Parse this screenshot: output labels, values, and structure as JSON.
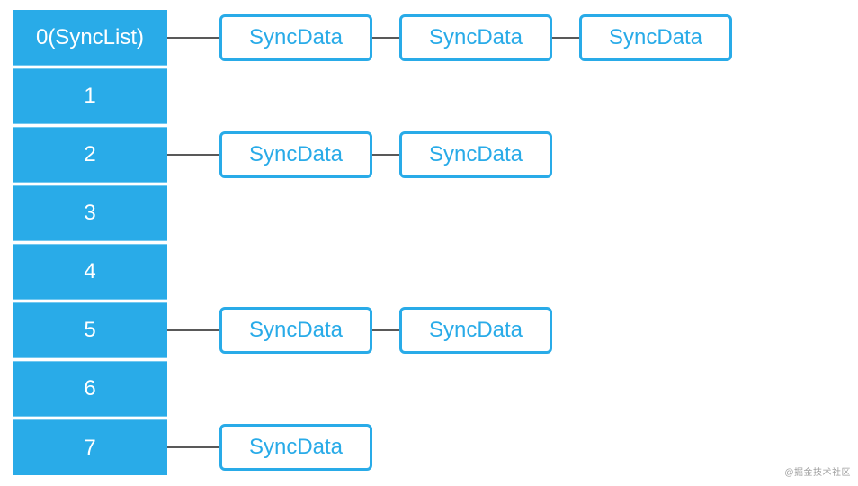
{
  "colors": {
    "accent": "#29abe8",
    "connector": "#595959",
    "node_text": "#29abe8",
    "slot_text": "#ffffff"
  },
  "slots": [
    {
      "label": "0(SyncList)",
      "nodes": [
        "SyncData",
        "SyncData",
        "SyncData"
      ]
    },
    {
      "label": "1",
      "nodes": []
    },
    {
      "label": "2",
      "nodes": [
        "SyncData",
        "SyncData"
      ]
    },
    {
      "label": "3",
      "nodes": []
    },
    {
      "label": "4",
      "nodes": []
    },
    {
      "label": "5",
      "nodes": [
        "SyncData",
        "SyncData"
      ]
    },
    {
      "label": "6",
      "nodes": []
    },
    {
      "label": "7",
      "nodes": [
        "SyncData"
      ]
    }
  ],
  "watermark": "@掘金技术社区"
}
